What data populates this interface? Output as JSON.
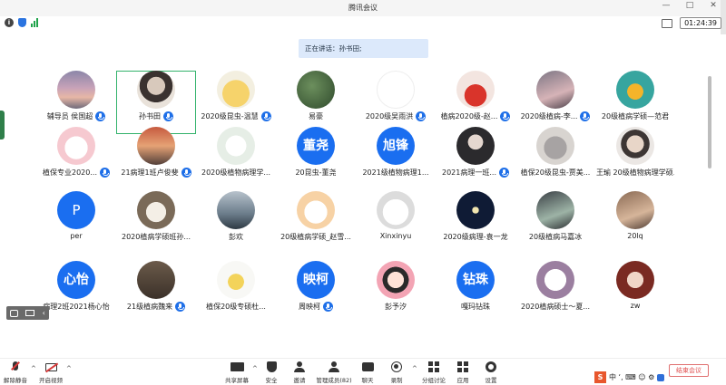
{
  "window": {
    "title": "腾讯会议",
    "controls": [
      "—",
      "□",
      "✕"
    ]
  },
  "infobar": {
    "timer": "01:24:39"
  },
  "speaking_banner": "正在讲话：孙书田;",
  "participants": [
    {
      "name": "辅导员 侯国超",
      "avatar": "av-sunset",
      "mic": true
    },
    {
      "name": "孙书田",
      "avatar": "av-girl",
      "mic": true,
      "active": true
    },
    {
      "name": "2020级昆虫-温慧",
      "avatar": "av-yellow",
      "mic": true
    },
    {
      "name": "易豪",
      "avatar": "av-green",
      "mic": false
    },
    {
      "name": "2020级吴雨洪",
      "avatar": "av-sketch",
      "mic": true
    },
    {
      "name": "植病2020级-赵...",
      "avatar": "av-red",
      "mic": true
    },
    {
      "name": "2020级植病-李...",
      "avatar": "av-pink",
      "mic": true
    },
    {
      "name": "20级植病学硕—范君",
      "avatar": "av-teal",
      "mic": false
    },
    {
      "name": "植保专业2020...",
      "avatar": "av-cat",
      "mic": true
    },
    {
      "name": "21病理1班卢俊斐",
      "avatar": "av-redsky",
      "mic": true
    },
    {
      "name": "2020级植物病理学...",
      "avatar": "av-bird",
      "mic": false
    },
    {
      "name": "20昆虫-董尧",
      "avatar_text": "董尧",
      "mic": false
    },
    {
      "name": "2021级植物病理1...",
      "avatar_text": "旭锋",
      "mic": false
    },
    {
      "name": "2021病理一班...",
      "avatar": "av-dark",
      "mic": true
    },
    {
      "name": "植保20级昆虫-贾美...",
      "avatar": "av-kitten",
      "mic": false
    },
    {
      "name": "王瑜 20级植物病理学硕...",
      "avatar": "av-boy",
      "mic": false
    },
    {
      "name": "per",
      "avatar_text": "P",
      "single": true,
      "mic": false
    },
    {
      "name": "2020植病学硕班孙...",
      "avatar": "av-dog",
      "mic": false
    },
    {
      "name": "彭欢",
      "avatar": "av-sky",
      "mic": false
    },
    {
      "name": "20级植病学硕_赵雪...",
      "avatar": "av-bunny",
      "mic": false
    },
    {
      "name": "Xinxinyu",
      "avatar": "av-study",
      "mic": false
    },
    {
      "name": "2020级病理-袁一龙",
      "avatar": "av-moon",
      "mic": false
    },
    {
      "name": "20级植病马嘉冰",
      "avatar": "av-anime",
      "mic": false
    },
    {
      "name": "20lq",
      "avatar": "av-warm",
      "mic": false
    },
    {
      "name": "病理2班2021杨心怡",
      "avatar_text": "心怡",
      "mic": false
    },
    {
      "name": "21级植病魏来",
      "avatar": "av-shelf",
      "mic": true
    },
    {
      "name": "植保20级专硕杜...",
      "avatar": "av-duck",
      "mic": false
    },
    {
      "name": "周映柯",
      "avatar_text": "映柯",
      "mic": true
    },
    {
      "name": "彭予汐",
      "avatar": "av-girl2",
      "mic": false
    },
    {
      "name": "嘎玛钻珠",
      "avatar_text": "钻珠",
      "mic": false
    },
    {
      "name": "2020植病硕士～夏...",
      "avatar": "av-cartoon",
      "mic": false
    },
    {
      "name": "zw",
      "avatar": "av-fire",
      "mic": false
    }
  ],
  "toolbar": {
    "unmute": "解除静音",
    "start_video": "开启视频",
    "share_screen": "共享屏幕",
    "security": "安全",
    "invite": "邀请",
    "manage_members": "管理成员(82)",
    "chat": "聊天",
    "record": "录制",
    "breakout": "分组讨论",
    "apps": "应用",
    "settings": "设置",
    "leave": "结束会议"
  },
  "tray": {
    "logo": "S",
    "text": "中 ‘,  ⌨ ☺ ⚙"
  }
}
